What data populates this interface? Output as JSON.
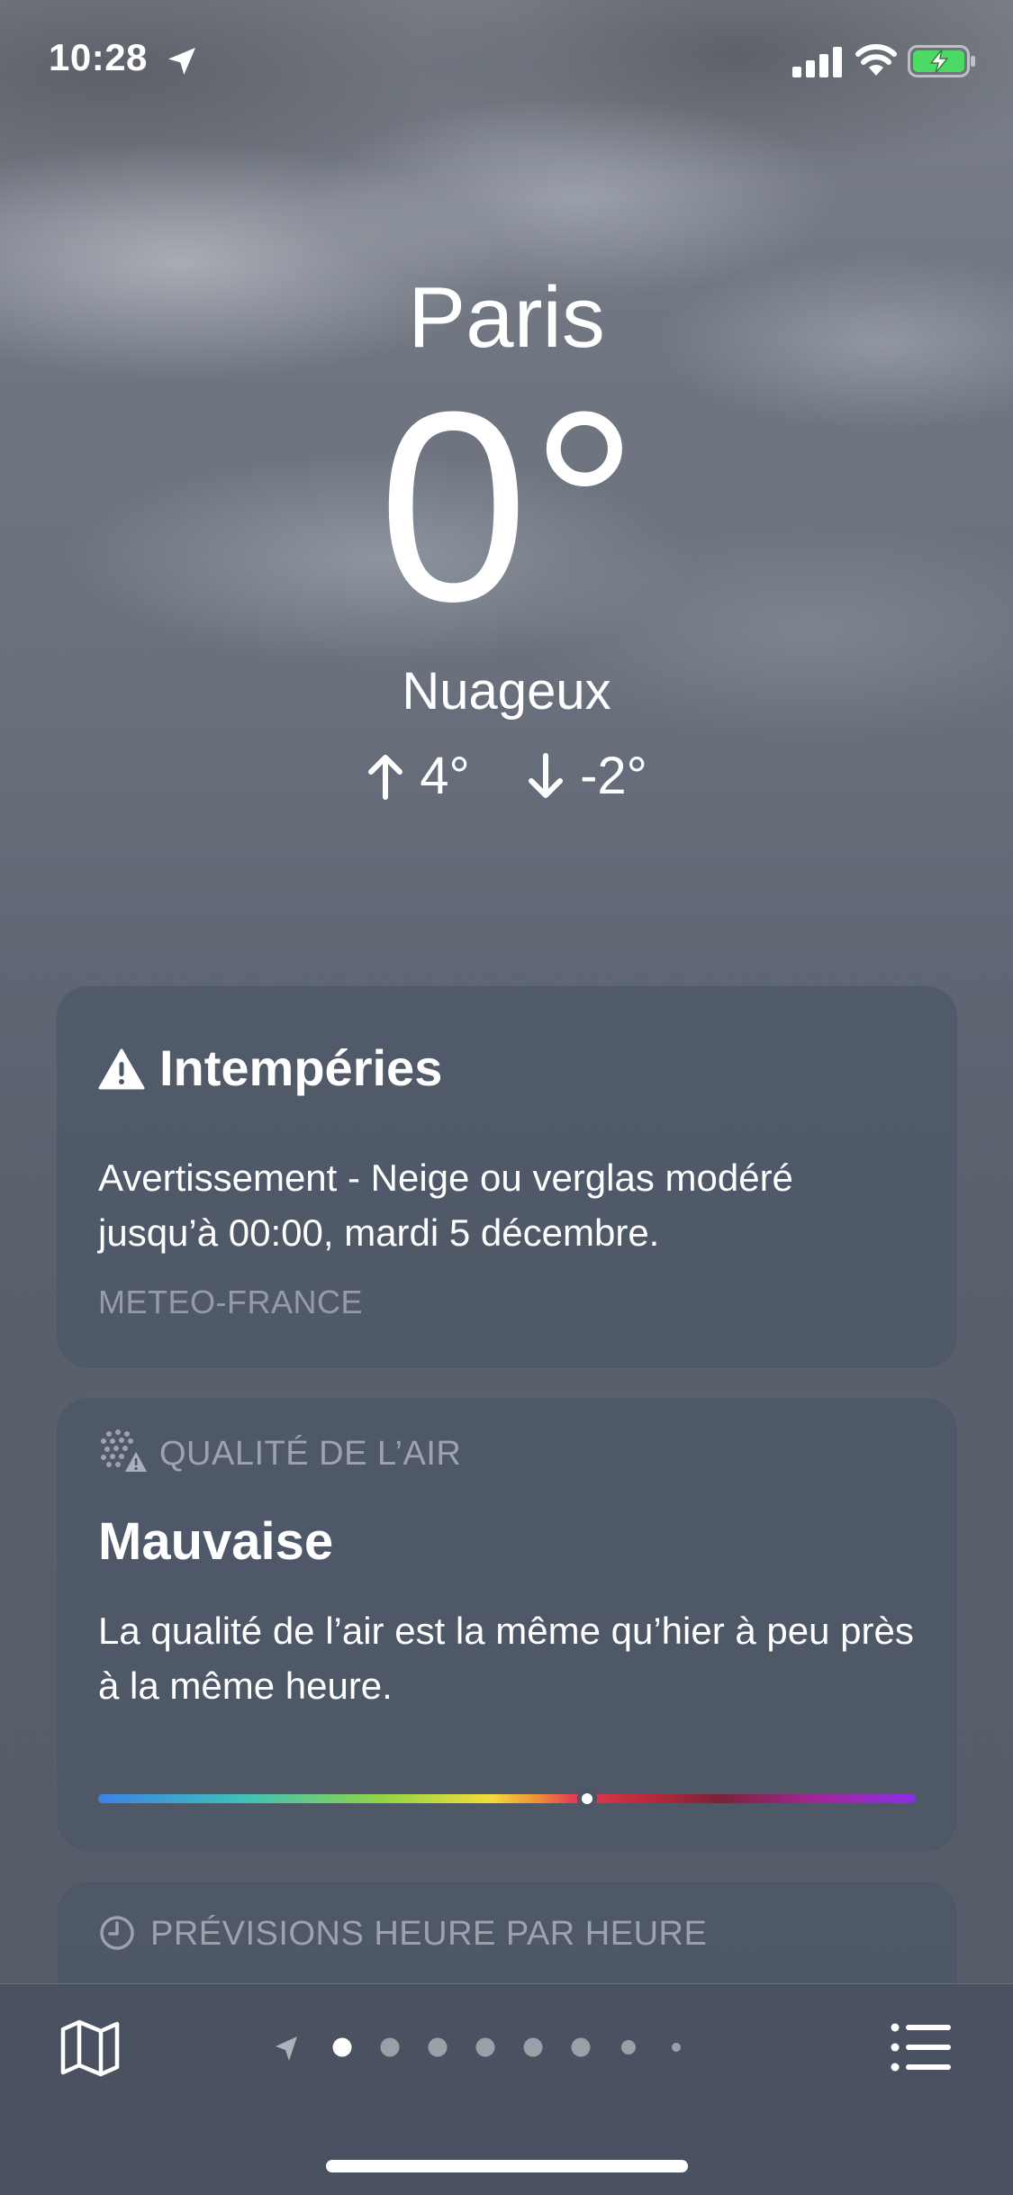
{
  "status_bar": {
    "time": "10:28"
  },
  "weather": {
    "city": "Paris",
    "temperature": "0",
    "degree_symbol": "°",
    "condition": "Nuageux",
    "high": "4°",
    "low": "-2°"
  },
  "alert_card": {
    "title": "Intempéries",
    "text": "Avertissement - Neige ou verglas modéré jusqu’à 00:00, mardi 5 décembre.",
    "source": "METEO-FRANCE"
  },
  "air_quality_card": {
    "label": "QUALITÉ DE L’AIR",
    "value": "Mauvaise",
    "description": "La qualité de l’air est la même qu’hier à peu près à la même heure.",
    "indicator_position": 0.598
  },
  "hourly_card": {
    "label": "PRÉVISIONS HEURE PAR HEURE"
  },
  "tab_bar": {
    "map_icon": "map-icon",
    "list_icon": "list-icon",
    "pages_total": 9,
    "current_page": 1
  },
  "colors": {
    "card_background": "#4c5666",
    "secondary_text": "#9aa0aa",
    "tab_bar": "#4a5262"
  }
}
